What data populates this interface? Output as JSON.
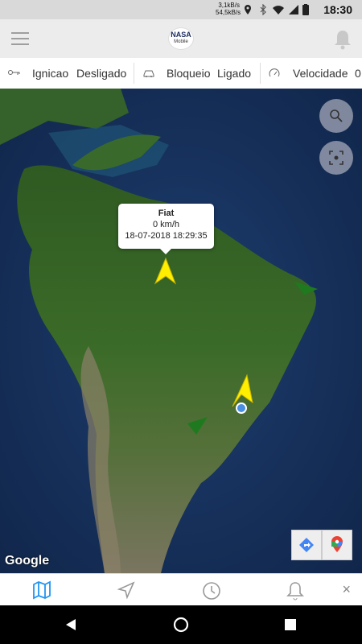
{
  "status_bar": {
    "net_up": "3,1kB/s",
    "net_down": "54,5kB/s",
    "time": "18:30"
  },
  "app": {
    "logo_line1": "NASA",
    "logo_line2": "Mobile"
  },
  "info_bar": {
    "ignition_label": "Ignicao",
    "ignition_value": "Desligado",
    "lock_label": "Bloqueio",
    "lock_value": "Ligado",
    "speed_label": "Velocidade",
    "speed_value": "0"
  },
  "popup": {
    "title": "Fiat",
    "speed": "0 km/h",
    "timestamp": "18-07-2018 18:29:35"
  },
  "map": {
    "attribution": "Google"
  },
  "colors": {
    "accent": "#2196f3",
    "marker_yellow": "#ffee00",
    "marker_green": "#1f7a1f"
  },
  "bottom_nav": {
    "items": [
      "map-icon",
      "navigation-icon",
      "history-icon",
      "bell-icon"
    ],
    "close": "×"
  }
}
